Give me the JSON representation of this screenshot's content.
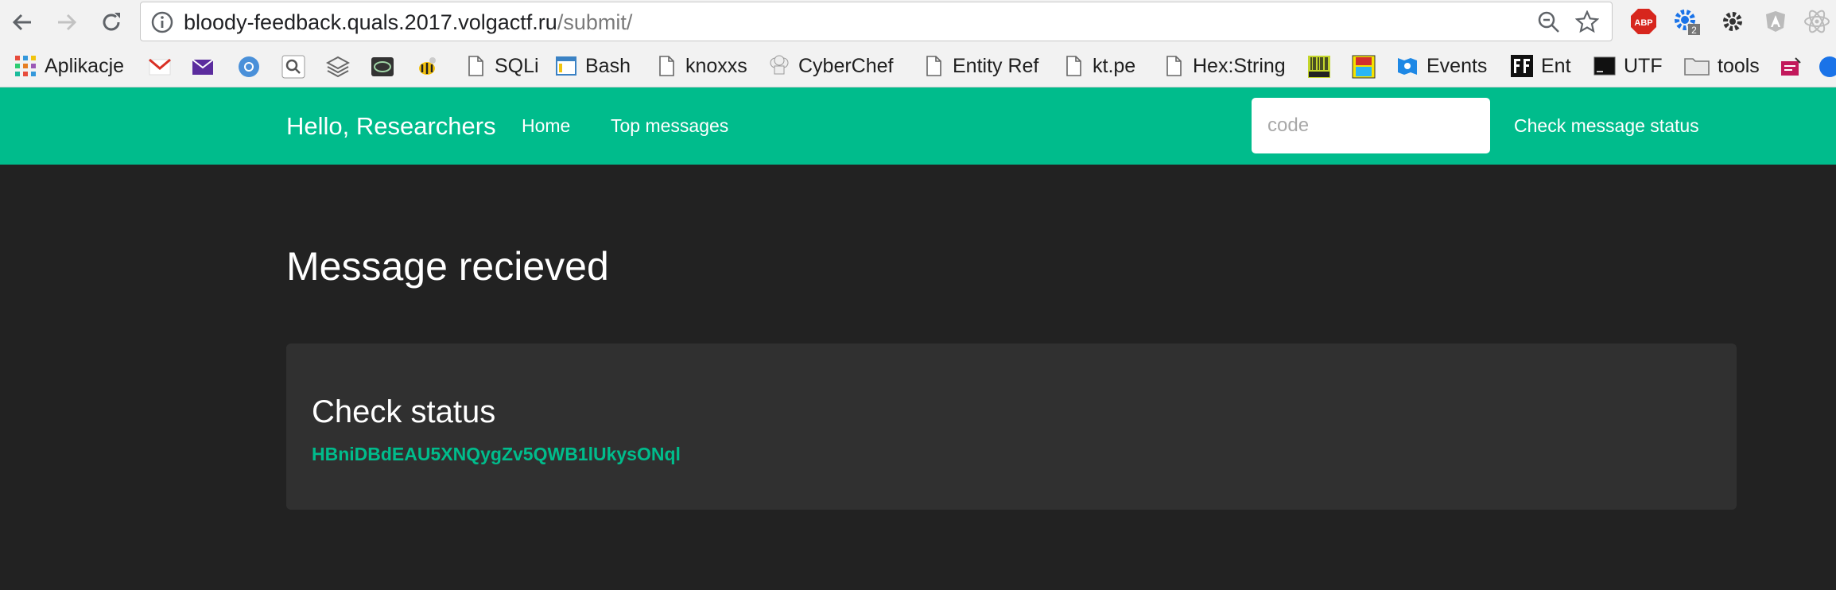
{
  "browser": {
    "url_host": "bloody-feedback.quals.2017.volgactf.ru",
    "url_path": "/submit/",
    "extension_badge": "2",
    "abp_label": "ABP"
  },
  "bookmarks": {
    "apps_label": "Aplikacje",
    "items": [
      "SQLi",
      "Bash",
      "knoxxs",
      "CyberChef",
      "Entity Ref",
      "kt.pe",
      "Hex:String",
      "Events",
      "Ent",
      "UTF",
      "tools"
    ]
  },
  "site": {
    "brand": "Hello, Researchers",
    "nav": {
      "home": "Home",
      "top_messages": "Top messages"
    },
    "code_placeholder": "code",
    "check_status_link": "Check message status"
  },
  "main": {
    "title": "Message recieved",
    "panel_title": "Check status",
    "status_code": "HBniDBdEAU5XNQygZv5QWB1lUkysONql"
  },
  "colors": {
    "accent": "#00bc8c",
    "background": "#222222",
    "panel": "#303030"
  }
}
